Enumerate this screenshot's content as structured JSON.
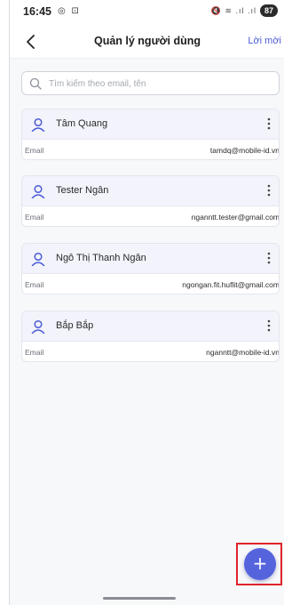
{
  "status_bar": {
    "time": "16:45",
    "left_icons": "◎ ⊡",
    "right_icons": "🔇 ≋ .ıl .ıl",
    "battery": "87"
  },
  "header": {
    "title": "Quản lý người dùng",
    "invite_label": "Lời mời",
    "back_icon": "chevron-left-icon"
  },
  "search": {
    "placeholder": "Tìm kiếm theo email, tên",
    "value": "",
    "icon": "search-icon"
  },
  "users": [
    {
      "name": "Tâm Quang",
      "email_label": "Email",
      "email": "tamdq@mobile-id.vn"
    },
    {
      "name": "Tester Ngân",
      "email_label": "Email",
      "email": "nganntt.tester@gmail.com"
    },
    {
      "name": "Ngô Thị Thanh Ngân",
      "email_label": "Email",
      "email": "ngongan.fit.huflit@gmail.com"
    },
    {
      "name": "Bắp Bắp",
      "email_label": "Email",
      "email": "nganntt@mobile-id.vn"
    }
  ],
  "fab": {
    "label": "+",
    "icon": "plus-icon"
  },
  "colors": {
    "accent": "#5564dd",
    "invite_text": "#4c5cd6",
    "card_header_bg": "#f2f3fb",
    "highlight_border": "#e0242b"
  }
}
